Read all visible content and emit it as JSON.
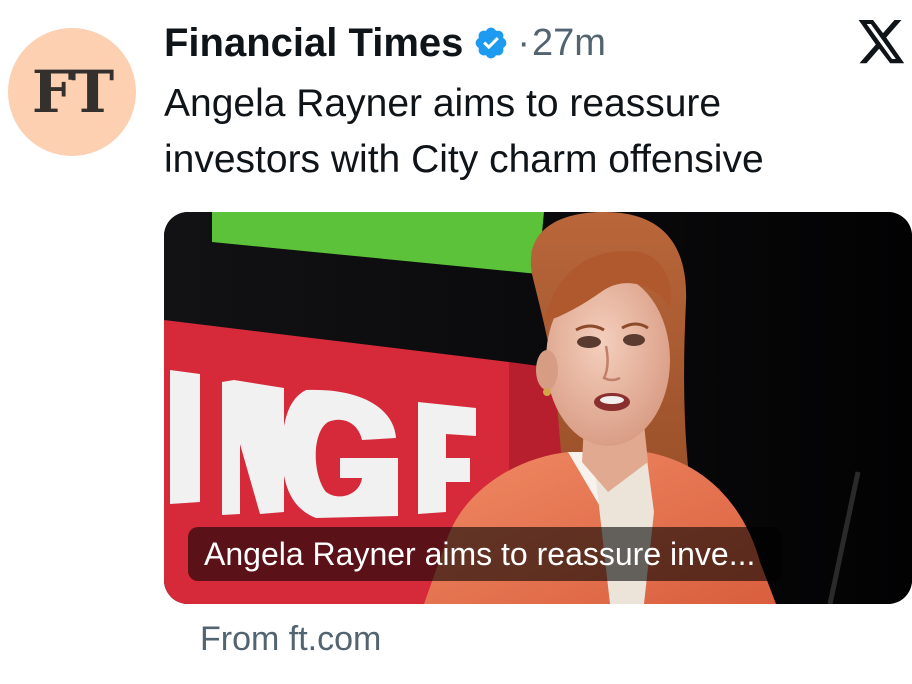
{
  "tweet": {
    "avatar_text": "FT",
    "author": "Financial Times",
    "separator": "·",
    "timestamp": "27m",
    "text": "Angela Rayner aims to reassure investors with City charm offensive"
  },
  "card": {
    "caption": "Angela Rayner aims to reassure inve...",
    "source": "From ft.com"
  },
  "icons": {
    "verified": "verified-badge-icon",
    "platform": "x-logo-icon"
  },
  "colors": {
    "avatar_bg": "#fcd0b1",
    "verified_blue": "#1d9bf0",
    "secondary_text": "#536471"
  }
}
